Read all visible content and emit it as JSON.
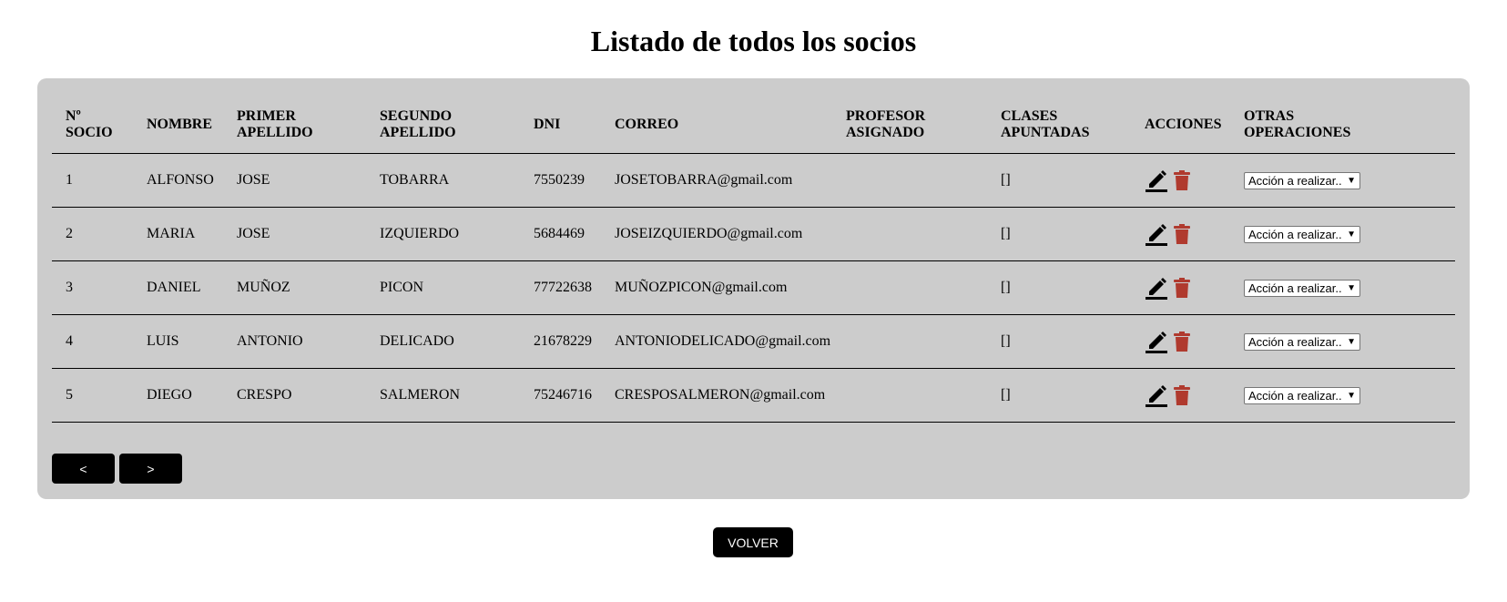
{
  "page": {
    "title": "Listado de todos los socios"
  },
  "table": {
    "headers": [
      [
        "Nº",
        "SOCIO"
      ],
      [
        "NOMBRE"
      ],
      [
        "PRIMER",
        "APELLIDO"
      ],
      [
        "SEGUNDO",
        "APELLIDO"
      ],
      [
        "DNI"
      ],
      [
        "CORREO"
      ],
      [
        "PROFESOR",
        "ASIGNADO"
      ],
      [
        "CLASES",
        "APUNTADAS"
      ],
      [
        "ACCIONES"
      ],
      [
        "OTRAS",
        "OPERACIONES"
      ]
    ],
    "rows": [
      {
        "socio": "1",
        "nombre": "ALFONSO",
        "primer_apellido": "JOSE",
        "segundo_apellido": "TOBARRA",
        "dni": "7550239",
        "correo": "JOSETOBARRA@gmail.com",
        "profesor": "",
        "clases": "[]",
        "accion": "Acción a realizar.."
      },
      {
        "socio": "2",
        "nombre": "MARIA",
        "primer_apellido": "JOSE",
        "segundo_apellido": "IZQUIERDO",
        "dni": "5684469",
        "correo": "JOSEIZQUIERDO@gmail.com",
        "profesor": "",
        "clases": "[]",
        "accion": "Acción a realizar.."
      },
      {
        "socio": "3",
        "nombre": "DANIEL",
        "primer_apellido": "MUÑOZ",
        "segundo_apellido": "PICON",
        "dni": "77722638",
        "correo": "MUÑOZPICON@gmail.com",
        "profesor": "",
        "clases": "[]",
        "accion": "Acción a realizar.."
      },
      {
        "socio": "4",
        "nombre": "LUIS",
        "primer_apellido": "ANTONIO",
        "segundo_apellido": "DELICADO",
        "dni": "21678229",
        "correo": "ANTONIODELICADO@gmail.com",
        "profesor": "",
        "clases": "[]",
        "accion": "Acción a realizar.."
      },
      {
        "socio": "5",
        "nombre": "DIEGO",
        "primer_apellido": "CRESPO",
        "segundo_apellido": "SALMERON",
        "dni": "75246716",
        "correo": "CRESPOSALMERON@gmail.com",
        "profesor": "",
        "clases": "[]",
        "accion": "Acción a realizar.."
      }
    ]
  },
  "pagination": {
    "prev_label": "<",
    "next_label": ">"
  },
  "volver_label": "VOLVER",
  "icons": {
    "edit": "pencil-icon",
    "delete": "trash-icon"
  },
  "colors": {
    "panel": "#cccccc",
    "delete_icon": "#b03a2e",
    "button": "#000000"
  }
}
